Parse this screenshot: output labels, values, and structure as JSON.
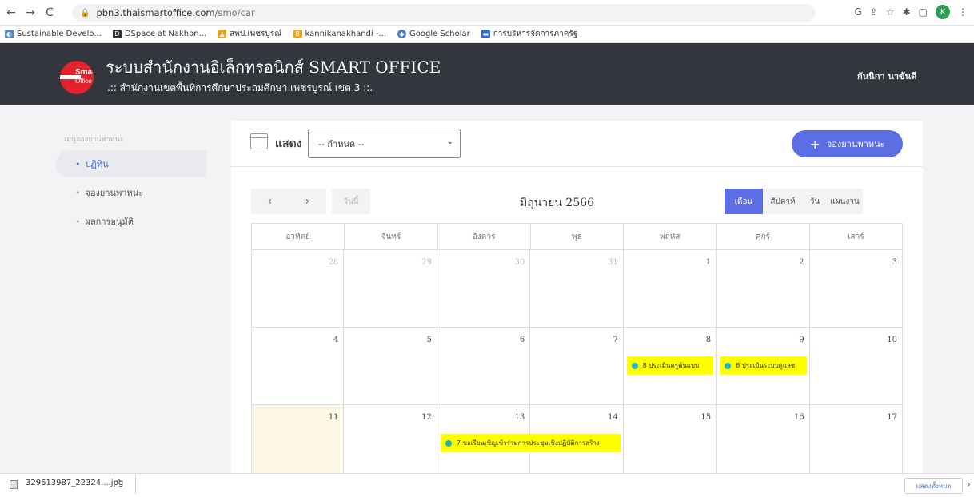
{
  "browser": {
    "url_host": "pbn3.thaismartoffice.com",
    "url_path": "/smo/car",
    "profile_initial": "K"
  },
  "bookmarks": [
    "Sustainable Develo...",
    "DSpace at Nakhon...",
    "สพป.เพชรบูรณ์",
    "kannikanakhandi -...",
    "Google Scholar",
    "การบริหารจัดการภาครัฐ"
  ],
  "header": {
    "logo_text_1": "Smart",
    "logo_text_2": "Office",
    "title": "ระบบสำนักงานอิเล็กทรอนิกส์ SMART OFFICE",
    "subtitle": ".:: สำนักงานเขตพื้นที่การศึกษาประถมศึกษา เพชรบูรณ์ เขต 3 ::.",
    "user": "กันนิกา นาขันดี"
  },
  "sidebar": {
    "heading": "เมนูจองยานพาหนะ",
    "items": [
      {
        "label": "ปฏิทิน",
        "active": true
      },
      {
        "label": "จองยานพาหนะ",
        "active": false
      },
      {
        "label": "ผลการอนุมัติ",
        "active": false
      }
    ]
  },
  "toolbar": {
    "show_label": "แสดง",
    "select_value": "-- กำหนด --",
    "book_button": "จองยานพาหนะ"
  },
  "calendar": {
    "today_label": "วันนี้",
    "title": "มิถุนายน 2566",
    "views": [
      "เดือน",
      "สัปดาห์",
      "วัน",
      "แผนงาน"
    ],
    "active_view": "เดือน",
    "weekdays": [
      "อาทิตย์",
      "จันทร์",
      "อังคาร",
      "พุธ",
      "พฤหัส",
      "ศุกร์",
      "เสาร์"
    ],
    "weeks": [
      [
        "28",
        "29",
        "30",
        "31",
        "1",
        "2",
        "3"
      ],
      [
        "4",
        "5",
        "6",
        "7",
        "8",
        "9",
        "10"
      ],
      [
        "11",
        "12",
        "13",
        "14",
        "15",
        "16",
        "17"
      ]
    ],
    "events": [
      {
        "text": "8 ประเมินครูต้นแบบ",
        "start_day": "8",
        "end_day": "8"
      },
      {
        "text": "8 ประเมินระบบดูแลช",
        "start_day": "9",
        "end_day": "9"
      },
      {
        "text": "7 ขอเรียนเชิญเข้าร่วมการประชุมเชิงปฏิบัติการสร้าง",
        "start_day": "13",
        "end_day": "14"
      }
    ]
  },
  "downloads": {
    "file": "329613987_22324....jpg",
    "show_all": "แสดงทั้งหมด"
  }
}
